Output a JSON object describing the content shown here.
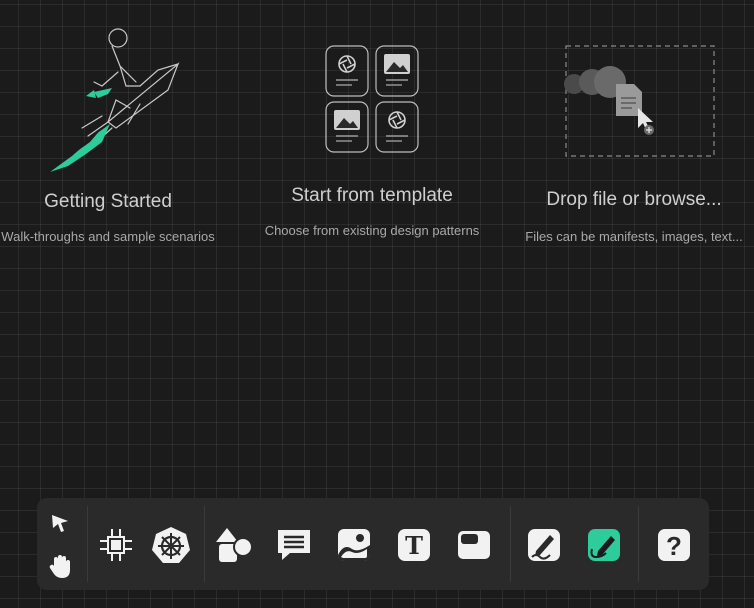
{
  "cards": {
    "getting_started": {
      "title": "Getting Started",
      "subtitle": "Walk-throughs and sample scenarios"
    },
    "template": {
      "title": "Start from template",
      "subtitle": "Choose from existing design patterns"
    },
    "drop": {
      "title": "Drop file or browse...",
      "subtitle": "Files can be manifests, images, text..."
    }
  },
  "toolbar": {
    "help_label": "?",
    "text_tool_label": "T",
    "tools": [
      {
        "icon": "pointer-icon"
      },
      {
        "icon": "pan-hand-icon"
      },
      {
        "icon": "component-icon"
      },
      {
        "icon": "kubernetes-icon"
      },
      {
        "icon": "shapes-icon"
      },
      {
        "icon": "comment-icon"
      },
      {
        "icon": "image-icon"
      },
      {
        "icon": "text-icon"
      },
      {
        "icon": "section-icon"
      },
      {
        "icon": "pen-icon"
      },
      {
        "icon": "freehand-draw-icon"
      },
      {
        "icon": "help-icon"
      }
    ]
  },
  "colors": {
    "background": "#1b1b1c",
    "accent": "#2ecc9a",
    "toolbar": "#2a2a2b",
    "icon_fill": "#f2f2f2"
  }
}
